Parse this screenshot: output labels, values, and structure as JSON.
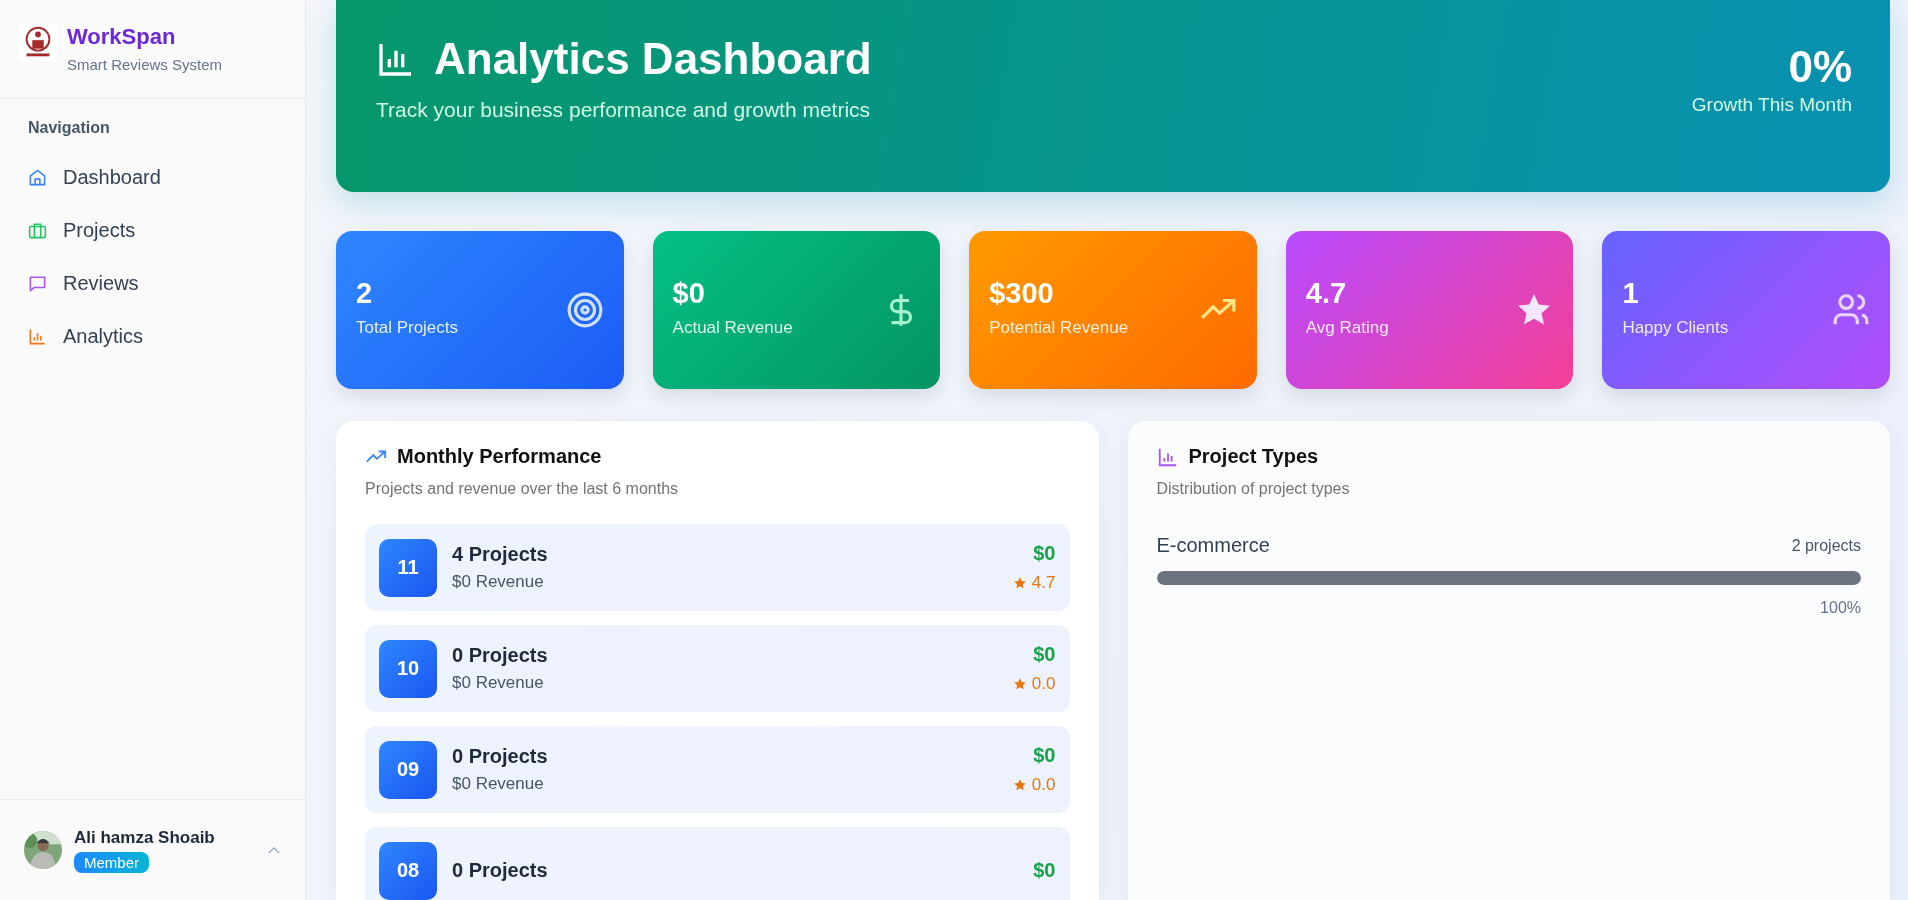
{
  "sidebar": {
    "brand": {
      "name": "WorkSpan",
      "tagline": "Smart Reviews System"
    },
    "section_label": "Navigation",
    "items": [
      {
        "label": "Dashboard",
        "selected": false
      },
      {
        "label": "Projects",
        "selected": false
      },
      {
        "label": "Reviews",
        "selected": false
      },
      {
        "label": "Analytics",
        "selected": false
      }
    ],
    "user": {
      "name": "Ali hamza Shoaib",
      "role": "Member"
    }
  },
  "header": {
    "title": "Analytics Dashboard",
    "subtitle": "Track your business performance and growth metrics",
    "growth_value": "0%",
    "growth_label": "Growth This Month"
  },
  "stats": [
    {
      "value": "2",
      "label": "Total Projects"
    },
    {
      "value": "$0",
      "label": "Actual Revenue"
    },
    {
      "value": "$300",
      "label": "Potential Revenue"
    },
    {
      "value": "4.7",
      "label": "Avg Rating"
    },
    {
      "value": "1",
      "label": "Happy Clients"
    }
  ],
  "monthly_performance": {
    "title": "Monthly Performance",
    "subtitle": "Projects and revenue over the last 6 months",
    "rows": [
      {
        "month": "11",
        "projects": "4 Projects",
        "revenue": "$0 Revenue",
        "amount": "$0",
        "rating": "4.7"
      },
      {
        "month": "10",
        "projects": "0 Projects",
        "revenue": "$0 Revenue",
        "amount": "$0",
        "rating": "0.0"
      },
      {
        "month": "09",
        "projects": "0 Projects",
        "revenue": "$0 Revenue",
        "amount": "$0",
        "rating": "0.0"
      },
      {
        "month": "08",
        "projects": "0 Projects",
        "amount": "$0"
      }
    ]
  },
  "project_types": {
    "title": "Project Types",
    "subtitle": "Distribution of project types",
    "items": [
      {
        "name": "E-commerce",
        "count": "2 projects",
        "level": 1,
        "percent": "100%"
      }
    ]
  }
}
